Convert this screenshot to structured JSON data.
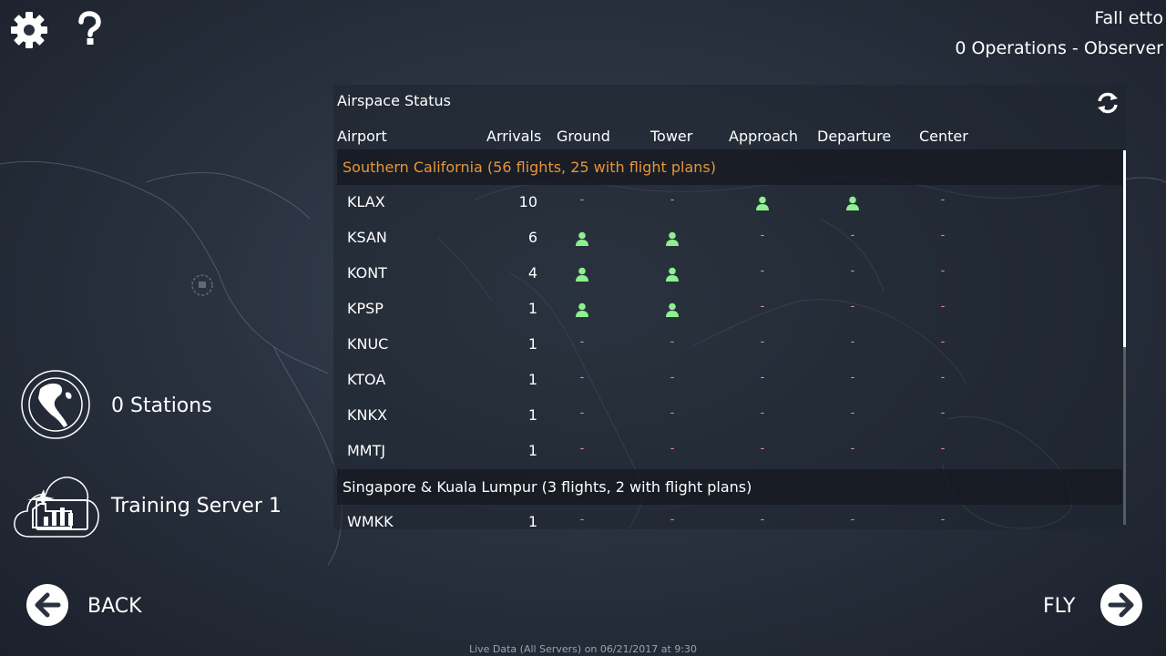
{
  "header": {
    "user_name": "Fall etto",
    "status": "0 Operations - Observer"
  },
  "panel": {
    "title": "Airspace Status",
    "columns": [
      "Airport",
      "Arrivals",
      "Ground",
      "Tower",
      "Approach",
      "Departure",
      "Center"
    ],
    "groups": [
      {
        "name": "Southern California (56 flights, 25 with flight plans)",
        "color": "#e8943a",
        "rows": [
          {
            "airport": "KLAX",
            "arrivals": "10",
            "ground": "-",
            "tower": "-",
            "approach": "staffed",
            "departure": "staffed",
            "center": "-"
          },
          {
            "airport": "KSAN",
            "arrivals": "6",
            "ground": "staffed",
            "tower": "staffed",
            "approach": "-",
            "departure": "-",
            "center": "-"
          },
          {
            "airport": "KONT",
            "arrivals": "4",
            "ground": "staffed",
            "tower": "staffed",
            "approach": "-",
            "departure": "-",
            "center": "-"
          },
          {
            "airport": "KPSP",
            "arrivals": "1",
            "ground": "staffed",
            "tower": "staffed",
            "approach": "-",
            "departure": "-",
            "center": "-"
          },
          {
            "airport": "KNUC",
            "arrivals": "1",
            "ground": "-",
            "tower": "-",
            "approach": "-",
            "departure": "-",
            "center": "-"
          },
          {
            "airport": "KTOA",
            "arrivals": "1",
            "ground": "-",
            "tower": "-",
            "approach": "-",
            "departure": "-",
            "center": "-"
          },
          {
            "airport": "KNKX",
            "arrivals": "1",
            "ground": "-",
            "tower": "-",
            "approach": "-",
            "departure": "-",
            "center": "-"
          },
          {
            "airport": "MMTJ",
            "arrivals": "1",
            "ground": "-",
            "tower": "-",
            "approach": "-",
            "departure": "-",
            "center": "-"
          }
        ]
      },
      {
        "name": "Singapore & Kuala Lumpur (3 flights, 2 with flight plans)",
        "color": "#ffffff",
        "rows": [
          {
            "airport": "WMKK",
            "arrivals": "1",
            "ground": "-",
            "tower": "-",
            "approach": "-",
            "departure": "-",
            "center": "-"
          }
        ]
      }
    ]
  },
  "sidebar": {
    "stations_label": "0 Stations",
    "server_label": "Training Server 1"
  },
  "nav": {
    "back_label": "BACK",
    "fly_label": "FLY"
  },
  "footer": "Live Data (All Servers) on 06/21/2017 at 9:30",
  "icons": {
    "settings": "gear-icon",
    "help": "question-icon",
    "refresh": "refresh-icon",
    "globe": "globe-icon",
    "server": "cloud-server-icon",
    "back": "arrow-left-icon",
    "fly": "arrow-right-icon",
    "staffed": "person-icon"
  },
  "colors": {
    "staffed": "#8ef08e",
    "unstaffed_dash": "#e88aa0",
    "group_highlight": "#e8943a"
  }
}
